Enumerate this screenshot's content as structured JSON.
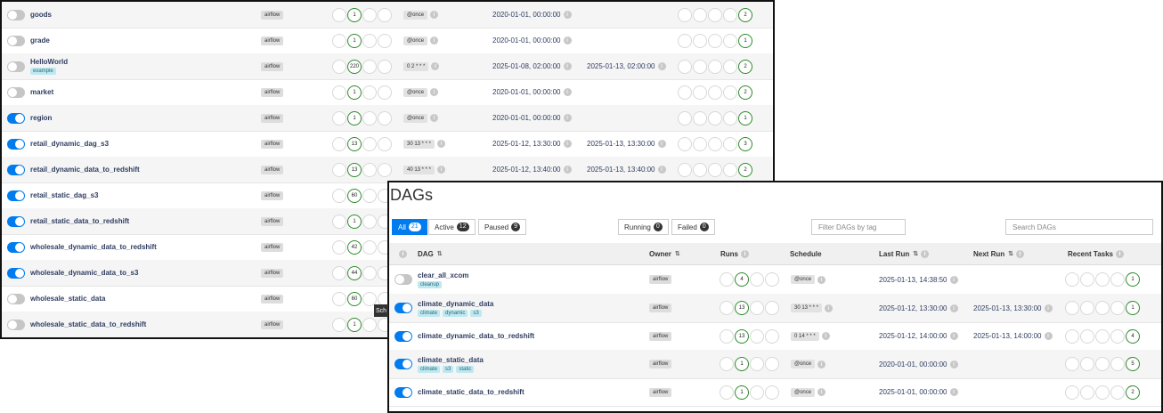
{
  "back_rows": [
    {
      "name": "goods",
      "on": false,
      "alt": true,
      "owner": "airflow",
      "runs": [
        "",
        "1",
        "",
        ""
      ],
      "runs_state": [
        0,
        1,
        0,
        0
      ],
      "schedule": "@once",
      "last_run": "2020-01-01, 00:00:00",
      "next_run": "",
      "recent": [
        "",
        "",
        "",
        "",
        "2"
      ]
    },
    {
      "name": "grade",
      "on": false,
      "alt": false,
      "owner": "airflow",
      "runs": [
        "",
        "1",
        "",
        ""
      ],
      "runs_state": [
        0,
        1,
        0,
        0
      ],
      "schedule": "@once",
      "last_run": "2020-01-01, 00:00:00",
      "next_run": "",
      "recent": [
        "",
        "",
        "",
        "",
        "1"
      ]
    },
    {
      "name": "HelloWorld",
      "tags": [
        "example"
      ],
      "on": false,
      "alt": true,
      "owner": "airflow",
      "runs": [
        "",
        "220",
        "",
        ""
      ],
      "runs_state": [
        0,
        1,
        0,
        0
      ],
      "schedule": "0 2 * * *",
      "last_run": "2025-01-08, 02:00:00",
      "next_run": "2025-01-13, 02:00:00",
      "recent": [
        "",
        "",
        "",
        "",
        "2"
      ]
    },
    {
      "name": "market",
      "on": false,
      "alt": false,
      "owner": "airflow",
      "runs": [
        "",
        "1",
        "",
        ""
      ],
      "runs_state": [
        0,
        1,
        0,
        0
      ],
      "schedule": "@once",
      "last_run": "2020-01-01, 00:00:00",
      "next_run": "",
      "recent": [
        "",
        "",
        "",
        "",
        "2"
      ]
    },
    {
      "name": "region",
      "on": true,
      "alt": true,
      "owner": "airflow",
      "runs": [
        "",
        "1",
        "",
        ""
      ],
      "runs_state": [
        0,
        1,
        0,
        0
      ],
      "schedule": "@once",
      "last_run": "2020-01-01, 00:00:00",
      "next_run": "",
      "recent": [
        "",
        "",
        "",
        "",
        "1"
      ]
    },
    {
      "name": "retail_dynamic_dag_s3",
      "on": true,
      "alt": false,
      "owner": "airflow",
      "runs": [
        "",
        "13",
        "",
        ""
      ],
      "runs_state": [
        0,
        1,
        0,
        0
      ],
      "schedule": "30 13 * * *",
      "last_run": "2025-01-12, 13:30:00",
      "next_run": "2025-01-13, 13:30:00",
      "recent": [
        "",
        "",
        "",
        "",
        "3"
      ]
    },
    {
      "name": "retail_dynamic_data_to_redshift",
      "on": true,
      "alt": true,
      "owner": "airflow",
      "runs": [
        "",
        "13",
        "",
        ""
      ],
      "runs_state": [
        0,
        1,
        0,
        0
      ],
      "schedule": "40 13 * * *",
      "last_run": "2025-01-12, 13:40:00",
      "next_run": "2025-01-13, 13:40:00",
      "recent": [
        "",
        "",
        "",
        "",
        "2"
      ]
    },
    {
      "name": "retail_static_dag_s3",
      "on": true,
      "alt": false,
      "owner": "airflow",
      "runs": [
        "",
        "60",
        "",
        ""
      ],
      "runs_state": [
        0,
        1,
        0,
        0
      ],
      "schedule": "",
      "last_run": "",
      "next_run": "",
      "recent": []
    },
    {
      "name": "retail_static_data_to_redshift",
      "on": true,
      "alt": true,
      "owner": "airflow",
      "runs": [
        "",
        "1",
        "",
        ""
      ],
      "runs_state": [
        0,
        1,
        0,
        0
      ],
      "schedule": "",
      "last_run": "",
      "next_run": "",
      "recent": []
    },
    {
      "name": "wholesale_dynamic_data_to_redshift",
      "on": true,
      "alt": false,
      "owner": "airflow",
      "runs": [
        "",
        "42",
        "",
        ""
      ],
      "runs_state": [
        0,
        1,
        0,
        0
      ],
      "schedule": "",
      "last_run": "",
      "next_run": "",
      "recent": []
    },
    {
      "name": "wholesale_dynamic_data_to_s3",
      "on": true,
      "alt": true,
      "owner": "airflow",
      "runs": [
        "",
        "44",
        "",
        ""
      ],
      "runs_state": [
        0,
        1,
        0,
        0
      ],
      "schedule": "",
      "last_run": "",
      "next_run": "",
      "recent": []
    },
    {
      "name": "wholesale_static_data",
      "on": false,
      "alt": false,
      "owner": "airflow",
      "runs": [
        "",
        "60",
        "",
        ""
      ],
      "runs_state": [
        0,
        1,
        0,
        0
      ],
      "schedule": "",
      "last_run": "",
      "next_run": "",
      "recent": []
    },
    {
      "name": "wholesale_static_data_to_redshift",
      "on": false,
      "alt": true,
      "owner": "airflow",
      "runs": [
        "",
        "1",
        "",
        ""
      ],
      "runs_state": [
        0,
        1,
        0,
        0
      ],
      "schedule": "",
      "last_run": "",
      "next_run": "",
      "recent": []
    }
  ],
  "tooltip_text": "Sch",
  "front": {
    "title": "DAGs",
    "filters": {
      "all": {
        "label": "All",
        "count": "21"
      },
      "active": {
        "label": "Active",
        "count": "12"
      },
      "paused": {
        "label": "Paused",
        "count": "9"
      },
      "running": {
        "label": "Running",
        "count": "0"
      },
      "failed": {
        "label": "Failed",
        "count": "0"
      }
    },
    "tag_filter_placeholder": "Filter DAGs by tag",
    "search_placeholder": "Search DAGs",
    "headers": {
      "dag": "DAG",
      "owner": "Owner",
      "runs": "Runs",
      "schedule": "Schedule",
      "last_run": "Last Run",
      "next_run": "Next Run",
      "recent_tasks": "Recent Tasks"
    },
    "rows": [
      {
        "name": "clear_all_xcom",
        "tags": [
          "cleanup"
        ],
        "on": false,
        "owner": "airflow",
        "runs": [
          "",
          "4",
          "",
          ""
        ],
        "schedule": "@once",
        "last_run": "2025-01-13, 14:38:50",
        "next_run": "",
        "recent": [
          "",
          "",
          "",
          "",
          "1"
        ]
      },
      {
        "name": "climate_dynamic_data",
        "tags": [
          "climate",
          "dynamic",
          "s3"
        ],
        "on": true,
        "owner": "airflow",
        "runs": [
          "",
          "13",
          "",
          ""
        ],
        "schedule": "30 13 * * *",
        "last_run": "2025-01-12, 13:30:00",
        "next_run": "2025-01-13, 13:30:00",
        "recent": [
          "",
          "",
          "",
          "",
          "1"
        ]
      },
      {
        "name": "climate_dynamic_data_to_redshift",
        "tags": [],
        "on": true,
        "owner": "airflow",
        "runs": [
          "",
          "13",
          "",
          ""
        ],
        "schedule": "0 14 * * *",
        "last_run": "2025-01-12, 14:00:00",
        "next_run": "2025-01-13, 14:00:00",
        "recent": [
          "",
          "",
          "",
          "",
          "4"
        ]
      },
      {
        "name": "climate_static_data",
        "tags": [
          "climate",
          "s3",
          "static"
        ],
        "on": true,
        "owner": "airflow",
        "runs": [
          "",
          "1",
          "",
          ""
        ],
        "schedule": "@once",
        "last_run": "2020-01-01, 00:00:00",
        "next_run": "",
        "recent": [
          "",
          "",
          "",
          "",
          "5"
        ]
      },
      {
        "name": "climate_static_data_to_redshift",
        "tags": [],
        "on": true,
        "owner": "airflow",
        "runs": [
          "",
          "1",
          "",
          ""
        ],
        "schedule": "@once",
        "last_run": "2025-01-01, 00:00:00",
        "next_run": "",
        "recent": [
          "",
          "",
          "",
          "",
          "2"
        ]
      }
    ]
  }
}
